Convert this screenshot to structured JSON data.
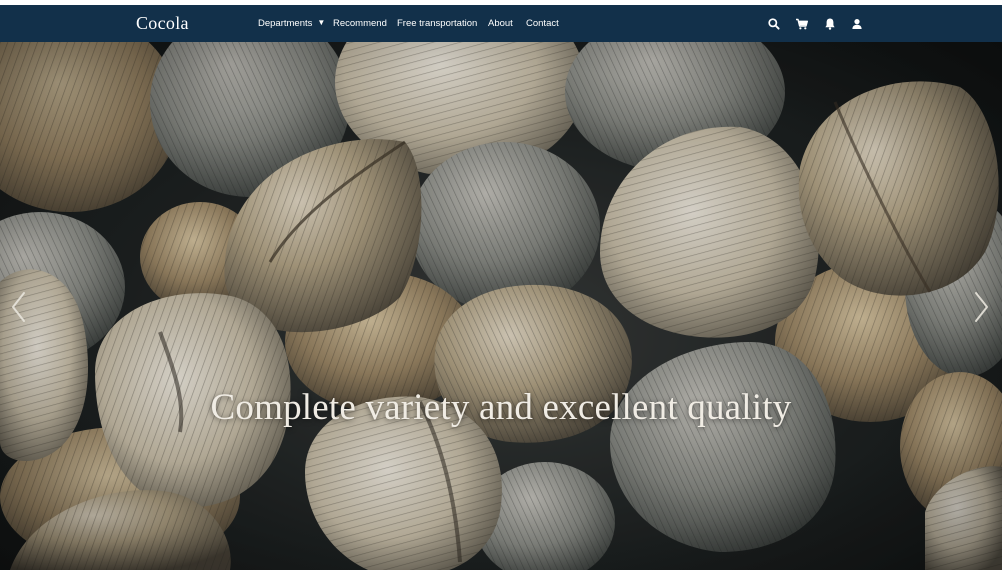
{
  "nav": {
    "brand": "Cocola",
    "items": [
      {
        "label": "Departments",
        "has_dropdown": true
      },
      {
        "label": "Recommend"
      },
      {
        "label": "Free transportation"
      },
      {
        "label": "About"
      },
      {
        "label": "Contact"
      }
    ],
    "icons": [
      "search-icon",
      "cart-icon",
      "bell-icon",
      "user-icon"
    ],
    "background_color": "#12304a"
  },
  "hero": {
    "title": "Complete variety and excellent quality",
    "image": "close-up of cockle seashells",
    "controls": [
      "chevron-left-icon",
      "chevron-right-icon"
    ]
  }
}
